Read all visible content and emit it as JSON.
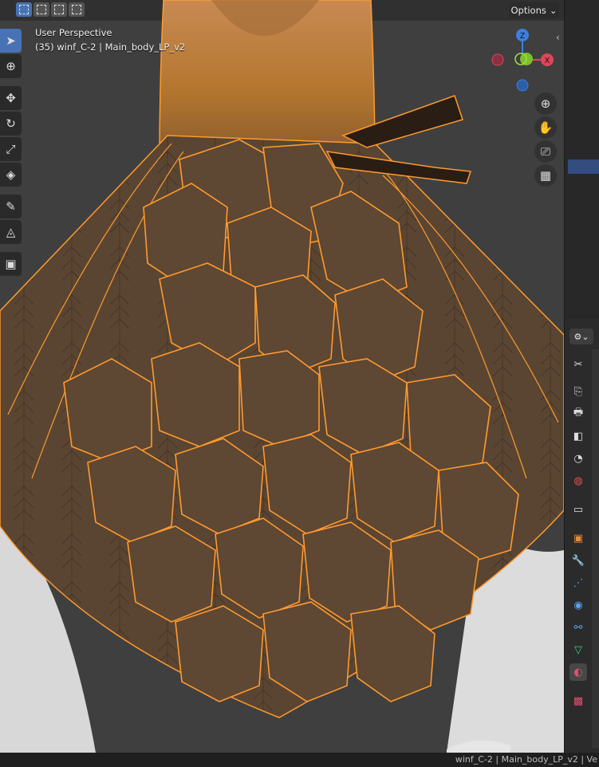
{
  "viewport": {
    "perspective_label": "User Perspective",
    "object_info": "(35) winf_C-2 | Main_body_LP_v2",
    "options_label": "Options",
    "gizmo": {
      "z_label": "Z",
      "x_label": "X",
      "colors": {
        "x": "#e0455a",
        "y": "#7fbf2a",
        "z": "#3d7fe0"
      }
    },
    "selection_outline_color": "#ff9a2e"
  },
  "toolbar": {
    "tools": [
      "select-box",
      "cursor",
      "move",
      "rotate",
      "scale",
      "transform",
      "annotate",
      "measure",
      "add-cube"
    ]
  },
  "properties": {
    "tabs": [
      "tool",
      "render",
      "output",
      "view-layer",
      "scene",
      "world",
      "collection",
      "object",
      "modifiers",
      "particles",
      "physics",
      "constraints",
      "data",
      "material",
      "texture"
    ]
  },
  "status_bar": {
    "text": "winf_C-2 | Main_body_LP_v2 | Ve"
  }
}
